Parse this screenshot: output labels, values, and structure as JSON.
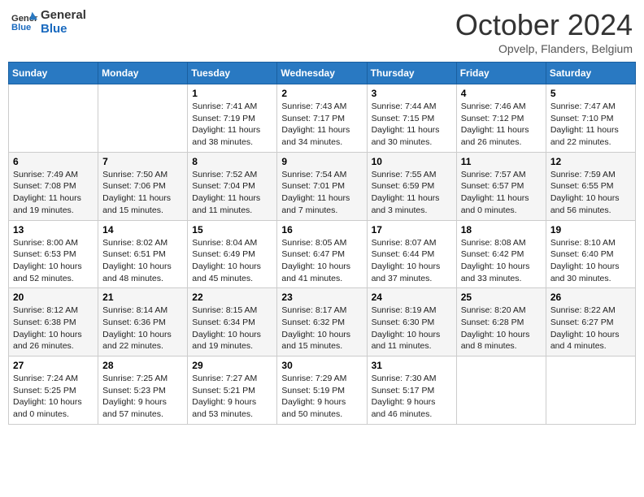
{
  "header": {
    "logo_line1": "General",
    "logo_line2": "Blue",
    "month_title": "October 2024",
    "subtitle": "Opvelp, Flanders, Belgium"
  },
  "days_of_week": [
    "Sunday",
    "Monday",
    "Tuesday",
    "Wednesday",
    "Thursday",
    "Friday",
    "Saturday"
  ],
  "weeks": [
    [
      {
        "day": "",
        "content": ""
      },
      {
        "day": "",
        "content": ""
      },
      {
        "day": "1",
        "content": "Sunrise: 7:41 AM\nSunset: 7:19 PM\nDaylight: 11 hours and 38 minutes."
      },
      {
        "day": "2",
        "content": "Sunrise: 7:43 AM\nSunset: 7:17 PM\nDaylight: 11 hours and 34 minutes."
      },
      {
        "day": "3",
        "content": "Sunrise: 7:44 AM\nSunset: 7:15 PM\nDaylight: 11 hours and 30 minutes."
      },
      {
        "day": "4",
        "content": "Sunrise: 7:46 AM\nSunset: 7:12 PM\nDaylight: 11 hours and 26 minutes."
      },
      {
        "day": "5",
        "content": "Sunrise: 7:47 AM\nSunset: 7:10 PM\nDaylight: 11 hours and 22 minutes."
      }
    ],
    [
      {
        "day": "6",
        "content": "Sunrise: 7:49 AM\nSunset: 7:08 PM\nDaylight: 11 hours and 19 minutes."
      },
      {
        "day": "7",
        "content": "Sunrise: 7:50 AM\nSunset: 7:06 PM\nDaylight: 11 hours and 15 minutes."
      },
      {
        "day": "8",
        "content": "Sunrise: 7:52 AM\nSunset: 7:04 PM\nDaylight: 11 hours and 11 minutes."
      },
      {
        "day": "9",
        "content": "Sunrise: 7:54 AM\nSunset: 7:01 PM\nDaylight: 11 hours and 7 minutes."
      },
      {
        "day": "10",
        "content": "Sunrise: 7:55 AM\nSunset: 6:59 PM\nDaylight: 11 hours and 3 minutes."
      },
      {
        "day": "11",
        "content": "Sunrise: 7:57 AM\nSunset: 6:57 PM\nDaylight: 11 hours and 0 minutes."
      },
      {
        "day": "12",
        "content": "Sunrise: 7:59 AM\nSunset: 6:55 PM\nDaylight: 10 hours and 56 minutes."
      }
    ],
    [
      {
        "day": "13",
        "content": "Sunrise: 8:00 AM\nSunset: 6:53 PM\nDaylight: 10 hours and 52 minutes."
      },
      {
        "day": "14",
        "content": "Sunrise: 8:02 AM\nSunset: 6:51 PM\nDaylight: 10 hours and 48 minutes."
      },
      {
        "day": "15",
        "content": "Sunrise: 8:04 AM\nSunset: 6:49 PM\nDaylight: 10 hours and 45 minutes."
      },
      {
        "day": "16",
        "content": "Sunrise: 8:05 AM\nSunset: 6:47 PM\nDaylight: 10 hours and 41 minutes."
      },
      {
        "day": "17",
        "content": "Sunrise: 8:07 AM\nSunset: 6:44 PM\nDaylight: 10 hours and 37 minutes."
      },
      {
        "day": "18",
        "content": "Sunrise: 8:08 AM\nSunset: 6:42 PM\nDaylight: 10 hours and 33 minutes."
      },
      {
        "day": "19",
        "content": "Sunrise: 8:10 AM\nSunset: 6:40 PM\nDaylight: 10 hours and 30 minutes."
      }
    ],
    [
      {
        "day": "20",
        "content": "Sunrise: 8:12 AM\nSunset: 6:38 PM\nDaylight: 10 hours and 26 minutes."
      },
      {
        "day": "21",
        "content": "Sunrise: 8:14 AM\nSunset: 6:36 PM\nDaylight: 10 hours and 22 minutes."
      },
      {
        "day": "22",
        "content": "Sunrise: 8:15 AM\nSunset: 6:34 PM\nDaylight: 10 hours and 19 minutes."
      },
      {
        "day": "23",
        "content": "Sunrise: 8:17 AM\nSunset: 6:32 PM\nDaylight: 10 hours and 15 minutes."
      },
      {
        "day": "24",
        "content": "Sunrise: 8:19 AM\nSunset: 6:30 PM\nDaylight: 10 hours and 11 minutes."
      },
      {
        "day": "25",
        "content": "Sunrise: 8:20 AM\nSunset: 6:28 PM\nDaylight: 10 hours and 8 minutes."
      },
      {
        "day": "26",
        "content": "Sunrise: 8:22 AM\nSunset: 6:27 PM\nDaylight: 10 hours and 4 minutes."
      }
    ],
    [
      {
        "day": "27",
        "content": "Sunrise: 7:24 AM\nSunset: 5:25 PM\nDaylight: 10 hours and 0 minutes."
      },
      {
        "day": "28",
        "content": "Sunrise: 7:25 AM\nSunset: 5:23 PM\nDaylight: 9 hours and 57 minutes."
      },
      {
        "day": "29",
        "content": "Sunrise: 7:27 AM\nSunset: 5:21 PM\nDaylight: 9 hours and 53 minutes."
      },
      {
        "day": "30",
        "content": "Sunrise: 7:29 AM\nSunset: 5:19 PM\nDaylight: 9 hours and 50 minutes."
      },
      {
        "day": "31",
        "content": "Sunrise: 7:30 AM\nSunset: 5:17 PM\nDaylight: 9 hours and 46 minutes."
      },
      {
        "day": "",
        "content": ""
      },
      {
        "day": "",
        "content": ""
      }
    ]
  ]
}
